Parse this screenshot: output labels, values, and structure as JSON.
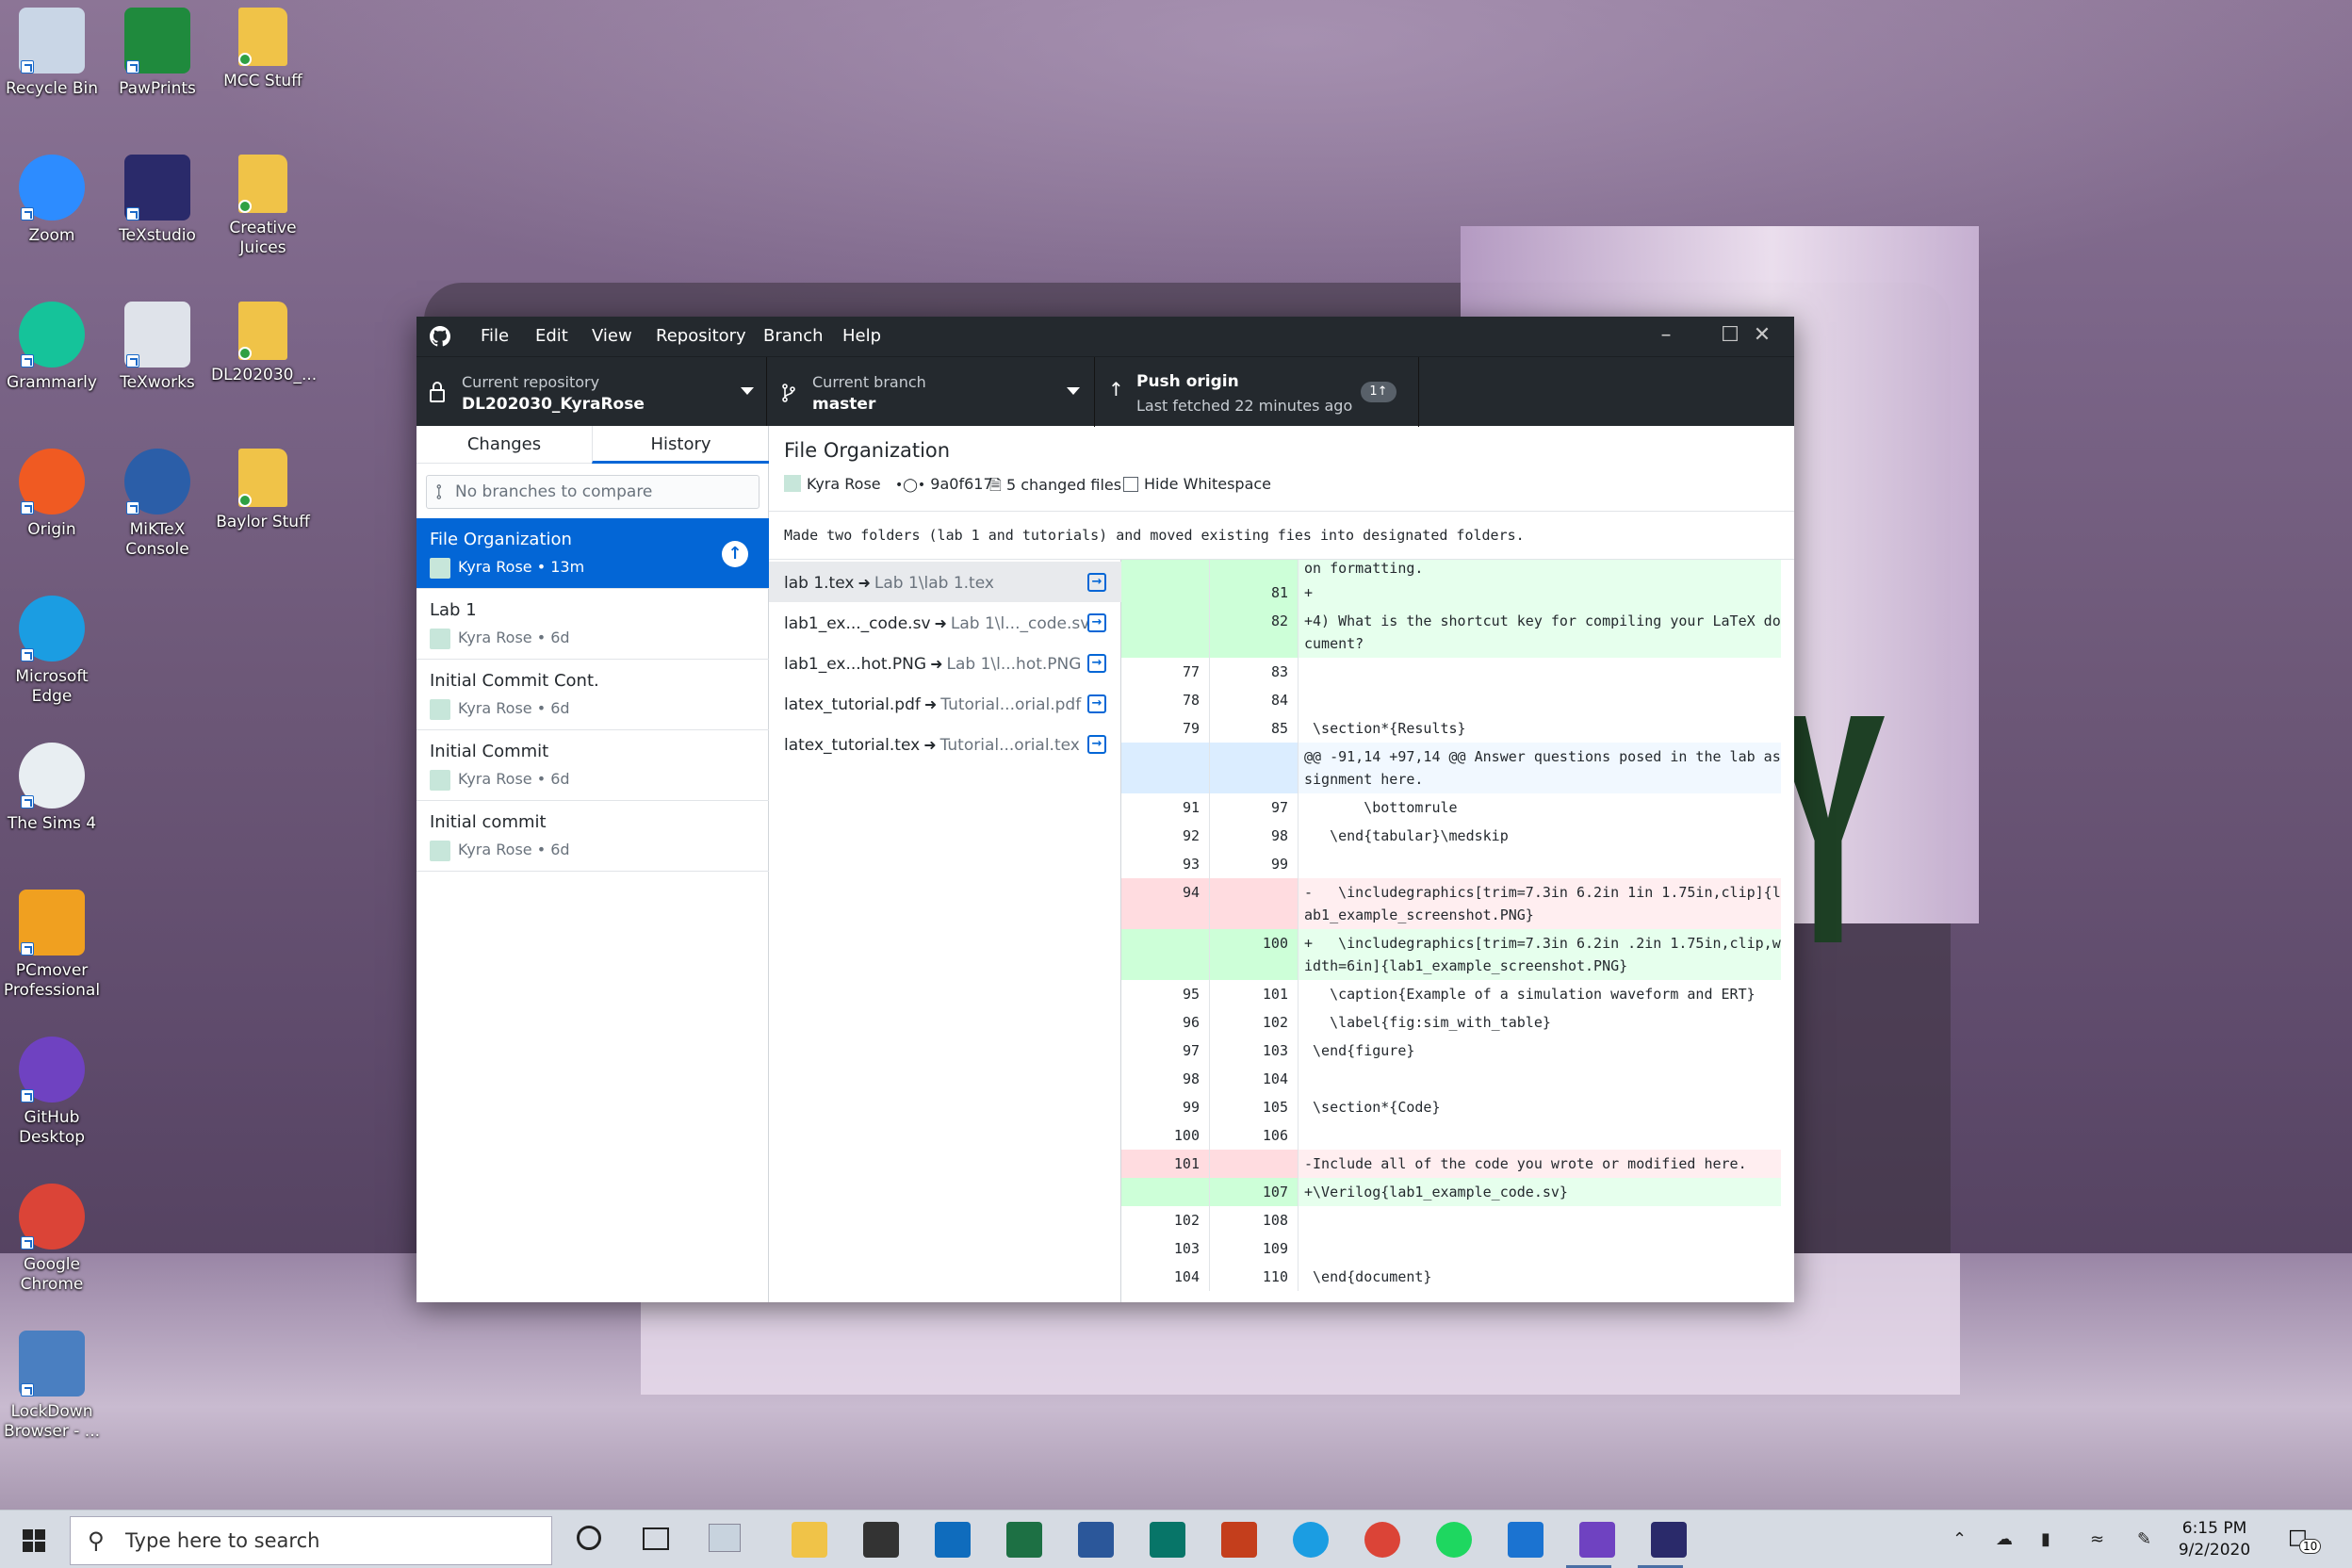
{
  "desktop_icons": [
    {
      "label": "Recycle Bin",
      "icon": "recycle-bin-icon"
    },
    {
      "label": "PawPrints",
      "icon": "pawprints-icon"
    },
    {
      "label": "MCC Stuff",
      "icon": "folder-icon"
    },
    {
      "label": "Zoom",
      "icon": "zoom-icon"
    },
    {
      "label": "TeXstudio",
      "icon": "texstudio-icon"
    },
    {
      "label": "Creative Juices",
      "icon": "folder-icon"
    },
    {
      "label": "Grammarly",
      "icon": "grammarly-icon"
    },
    {
      "label": "TeXworks",
      "icon": "texworks-icon"
    },
    {
      "label": "DL202030_...",
      "icon": "folder-icon"
    },
    {
      "label": "Origin",
      "icon": "origin-icon"
    },
    {
      "label": "MiKTeX Console",
      "icon": "miktex-icon"
    },
    {
      "label": "Baylor Stuff",
      "icon": "folder-icon"
    },
    {
      "label": "Microsoft Edge",
      "icon": "edge-icon"
    },
    {
      "label": "The Sims 4",
      "icon": "sims-icon"
    },
    {
      "label": "PCmover Professional",
      "icon": "pcmover-icon"
    },
    {
      "label": "GitHub Desktop",
      "icon": "github-desktop-icon"
    },
    {
      "label": "Google Chrome",
      "icon": "chrome-icon"
    },
    {
      "label": "LockDown Browser - ...",
      "icon": "lockdown-browser-icon"
    }
  ],
  "menu": [
    "File",
    "Edit",
    "View",
    "Repository",
    "Branch",
    "Help"
  ],
  "toolbar": {
    "repo_label": "Current repository",
    "repo_value": "DL202030_KyraRose",
    "branch_label": "Current branch",
    "branch_value": "master",
    "push_label": "Push origin",
    "push_sub": "Last fetched 22 minutes ago",
    "push_badge": "1↑"
  },
  "tabs": {
    "changes": "Changes",
    "history": "History"
  },
  "compare_placeholder": "No branches to compare",
  "commits": [
    {
      "title": "File Organization",
      "meta": "Kyra Rose • 13m"
    },
    {
      "title": "Lab 1",
      "meta": "Kyra Rose • 6d"
    },
    {
      "title": "Initial Commit Cont.",
      "meta": "Kyra Rose • 6d"
    },
    {
      "title": "Initial Commit",
      "meta": "Kyra Rose • 6d"
    },
    {
      "title": "Initial commit",
      "meta": "Kyra Rose • 6d"
    }
  ],
  "detail": {
    "title": "File Organization",
    "author": "Kyra Rose",
    "sha": "9a0f617",
    "changed": "5 changed files",
    "hide_ws": "Hide Whitespace",
    "message": "Made two folders (lab 1 and tutorials) and moved existing fies into designated folders."
  },
  "files": [
    {
      "from": "lab 1.tex",
      "to": "Lab 1\\lab 1.tex"
    },
    {
      "from": "lab1_ex..._code.sv",
      "to": "Lab 1\\l..._code.sv"
    },
    {
      "from": "lab1_ex...hot.PNG",
      "to": "Lab 1\\l...hot.PNG"
    },
    {
      "from": "latex_tutorial.pdf",
      "to": "Tutorial...orial.pdf"
    },
    {
      "from": "latex_tutorial.tex",
      "to": "Tutorial...orial.tex"
    }
  ],
  "diff": [
    {
      "type": "add",
      "old": "",
      "new": "",
      "text": "on formatting."
    },
    {
      "type": "add",
      "old": "",
      "new": "81",
      "text": "+"
    },
    {
      "type": "add",
      "old": "",
      "new": "82",
      "text": "+4) What is the shortcut key for compiling your LaTeX document?"
    },
    {
      "type": "ctx",
      "old": "77",
      "new": "83",
      "text": ""
    },
    {
      "type": "ctx",
      "old": "78",
      "new": "84",
      "text": ""
    },
    {
      "type": "ctx",
      "old": "79",
      "new": "85",
      "text": " \\section*{Results}"
    },
    {
      "type": "hunk",
      "old": "",
      "new": "",
      "text": "@@ -91,14 +97,14 @@ Answer questions posed in the lab assignment here."
    },
    {
      "type": "ctx",
      "old": "91",
      "new": "97",
      "text": "       \\bottomrule"
    },
    {
      "type": "ctx",
      "old": "92",
      "new": "98",
      "text": "   \\end{tabular}\\medskip"
    },
    {
      "type": "ctx",
      "old": "93",
      "new": "99",
      "text": ""
    },
    {
      "type": "del",
      "old": "94",
      "new": "",
      "text": "-   \\includegraphics[trim=7.3in 6.2in 1in 1.75in,clip]{lab1_example_screenshot.PNG}"
    },
    {
      "type": "add",
      "old": "",
      "new": "100",
      "text": "+   \\includegraphics[trim=7.3in 6.2in .2in 1.75in,clip,width=6in]{lab1_example_screenshot.PNG}"
    },
    {
      "type": "ctx",
      "old": "95",
      "new": "101",
      "text": "   \\caption{Example of a simulation waveform and ERT}"
    },
    {
      "type": "ctx",
      "old": "96",
      "new": "102",
      "text": "   \\label{fig:sim_with_table}"
    },
    {
      "type": "ctx",
      "old": "97",
      "new": "103",
      "text": " \\end{figure}"
    },
    {
      "type": "ctx",
      "old": "98",
      "new": "104",
      "text": ""
    },
    {
      "type": "ctx",
      "old": "99",
      "new": "105",
      "text": " \\section*{Code}"
    },
    {
      "type": "ctx",
      "old": "100",
      "new": "106",
      "text": ""
    },
    {
      "type": "del",
      "old": "101",
      "new": "",
      "text": "-Include all of the code you wrote or modified here."
    },
    {
      "type": "add",
      "old": "",
      "new": "107",
      "text": "+\\Verilog{lab1_example_code.sv}"
    },
    {
      "type": "ctx",
      "old": "102",
      "new": "108",
      "text": ""
    },
    {
      "type": "ctx",
      "old": "103",
      "new": "109",
      "text": ""
    },
    {
      "type": "ctx",
      "old": "104",
      "new": "110",
      "text": " \\end{document}"
    }
  ],
  "taskbar": {
    "search_placeholder": "Type here to search",
    "time": "6:15 PM",
    "date": "9/2/2020",
    "notifications": "10"
  },
  "colors": {
    "accent": "#0366d6",
    "titlebar": "#24292e",
    "add_bg": "#e6ffed",
    "del_bg": "#ffeef0"
  }
}
